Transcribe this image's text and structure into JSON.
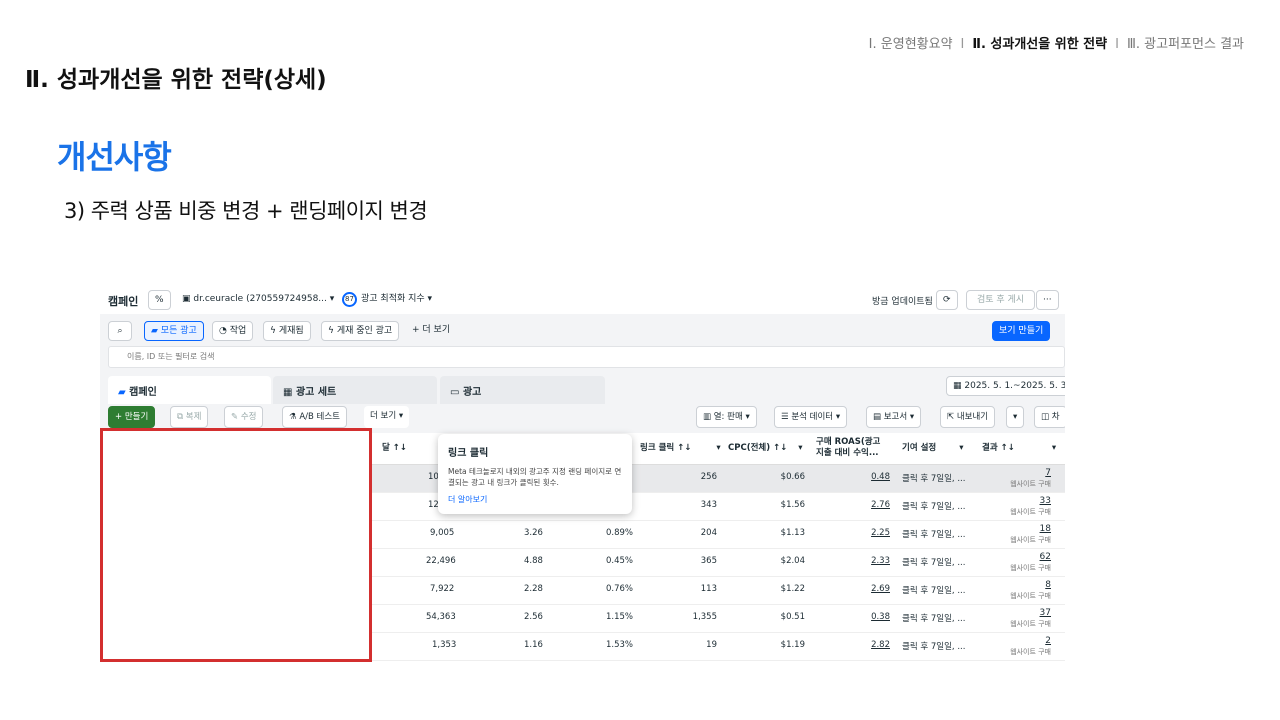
{
  "slide": {
    "nav": [
      {
        "label": "Ⅰ. 운영현황요약"
      },
      {
        "label": "Ⅱ. 성과개선을 위한 전략",
        "active": true
      },
      {
        "label": "Ⅲ. 광고퍼포먼스 결과"
      }
    ],
    "nav_sep": "I",
    "title": "Ⅱ. 성과개선을 위한 전략(상세)",
    "section": "개선사항",
    "subtitle": "3) 주력 상품 비중 변경 + 랜딩페이지 변경",
    "colors": {
      "section": "#1a73e8",
      "redact_border": "#d32f2f",
      "meta_blue": "#0866ff",
      "create_green": "#2e7d32"
    }
  },
  "app": {
    "campaign_label": "캠페인",
    "percent_chip": "%",
    "account": "dr.ceuracle (270559724958...",
    "score": "87",
    "score_label": "광고 최적화 지수",
    "updated": "방금 업데이트됨",
    "review_btn": "검토 후 게시",
    "more_btn": "···",
    "filters": [
      "모든 광고",
      "작업",
      "게재됨",
      "게재 중인 광고"
    ],
    "more_view": "더 보기",
    "create_view": "보기 만들기",
    "search_placeholder": "이름, ID 또는 필터로 검색",
    "tabs": [
      "캠페인",
      "광고 세트",
      "광고"
    ],
    "date_range": "2025. 5. 1.~2025. 5. 31.",
    "toolbar": {
      "create": "만들기",
      "duplicate": "복제",
      "edit": "수정",
      "ab_test": "A/B 테스트",
      "more": "더 보기",
      "columns": "열: 판매",
      "breakdown": "분석 데이터",
      "reports": "보고서",
      "export": "내보내기",
      "chart": "차"
    },
    "headers": {
      "h1": "달 ↑↓",
      "link_clicks": "링크 클릭 ↑↓",
      "cpc": "CPC(전체) ↑↓",
      "roas_line1": "구매 ROAS(광고",
      "roas_line2": "지출 대비 수익...",
      "attribution": "기여 설정",
      "results": "결과 ↑↓"
    },
    "rows": [
      {
        "c1": "10,",
        "c2": "",
        "c3": "",
        "clicks": "256",
        "cpc": "$0.66",
        "roas": "0.48",
        "attr": "클릭 후 7일일, ...",
        "res": "7",
        "res_label": "웹사이트 구매"
      },
      {
        "c1": "12,",
        "c2": "",
        "c3": "",
        "clicks": "343",
        "cpc": "$1.56",
        "roas": "2.76",
        "attr": "클릭 후 7일일, ...",
        "res": "33",
        "res_label": "웹사이트 구매"
      },
      {
        "c1": "9,005",
        "c2": "3.26",
        "c3": "0.89%",
        "clicks": "204",
        "cpc": "$1.13",
        "roas": "2.25",
        "attr": "클릭 후 7일일, ...",
        "res": "18",
        "res_label": "웹사이트 구매"
      },
      {
        "c1": "22,496",
        "c2": "4.88",
        "c3": "0.45%",
        "clicks": "365",
        "cpc": "$2.04",
        "roas": "2.33",
        "attr": "클릭 후 7일일, ...",
        "res": "62",
        "res_label": "웹사이트 구매"
      },
      {
        "c1": "7,922",
        "c2": "2.28",
        "c3": "0.76%",
        "clicks": "113",
        "cpc": "$1.22",
        "roas": "2.69",
        "attr": "클릭 후 7일일, ...",
        "res": "8",
        "res_label": "웹사이트 구매"
      },
      {
        "c1": "54,363",
        "c2": "2.56",
        "c3": "1.15%",
        "clicks": "1,355",
        "cpc": "$0.51",
        "roas": "0.38",
        "attr": "클릭 후 7일일, ...",
        "res": "37",
        "res_label": "웹사이트 구매"
      },
      {
        "c1": "1,353",
        "c2": "1.16",
        "c3": "1.53%",
        "clicks": "19",
        "cpc": "$1.19",
        "roas": "2.82",
        "attr": "클릭 후 7일일, ...",
        "res": "2",
        "res_label": "웹사이트 구매"
      }
    ],
    "tooltip": {
      "title": "링크 클릭",
      "desc": "Meta 테크놀로지 내외의 광고주 지정 랜딩 페이지로 연결되는 광고 내 링크가 클릭된 횟수.",
      "link": "더 알아보기"
    },
    "icons": [
      "search-icon",
      "folder-icon",
      "refresh-icon",
      "bolt-icon",
      "columns-icon",
      "calendar-icon",
      "export-icon",
      "chart-icon",
      "flask-icon",
      "pencil-icon",
      "copy-icon"
    ]
  }
}
